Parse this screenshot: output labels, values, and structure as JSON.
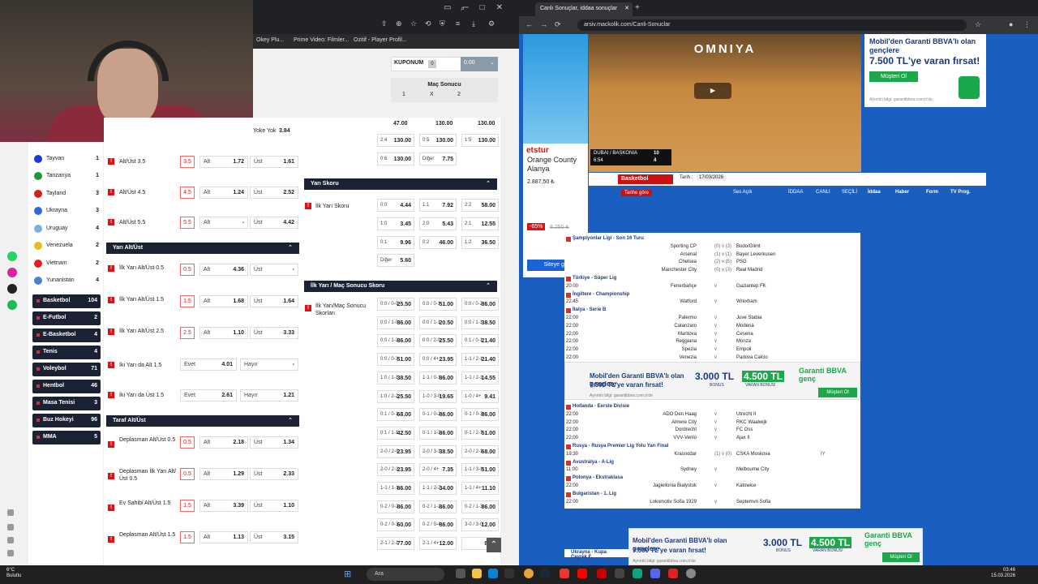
{
  "left_browser": {
    "bookmarks": [
      "Okey Plu...",
      "Prime Video: Filmler...",
      "Ozitif - Player Profil..."
    ],
    "coupon": {
      "label": "KUPONUM",
      "count": "0",
      "amount": "0.00"
    },
    "match_result": {
      "title": "Maç Sonucu",
      "cols": [
        "1",
        "X",
        "2"
      ]
    },
    "countries": [
      {
        "name": "Tayvan",
        "count": "1"
      },
      {
        "name": "Tanzanya",
        "count": "1"
      },
      {
        "name": "Tayland",
        "count": "3"
      },
      {
        "name": "Ukrayna",
        "count": "3"
      },
      {
        "name": "Uruguay",
        "count": "4"
      },
      {
        "name": "Venezuela",
        "count": "2"
      },
      {
        "name": "Vietnam",
        "count": "2"
      },
      {
        "name": "Yunanistan",
        "count": "4"
      }
    ],
    "sports": [
      {
        "name": "Basketbol",
        "count": "104"
      },
      {
        "name": "E-Futbol",
        "count": "2"
      },
      {
        "name": "E-Basketbol",
        "count": "4"
      },
      {
        "name": "Tenis",
        "count": "4"
      },
      {
        "name": "Voleybol",
        "count": "71"
      },
      {
        "name": "Hentbol",
        "count": "46"
      },
      {
        "name": "Masa Tenisi",
        "count": "3"
      },
      {
        "name": "Buz Hokeyi",
        "count": "96"
      },
      {
        "name": "MMA",
        "count": "5"
      }
    ],
    "col1": {
      "top_partial": {
        "label": "Yoke Yok",
        "value": "3.84"
      },
      "alt_ust": [
        {
          "label": "Alt/Üst 3.5",
          "line": "3.5",
          "alt": "1.72",
          "ust": "1.61"
        },
        {
          "label": "Alt/Üst 4.5",
          "line": "4.5",
          "alt": "1.24",
          "ust": "2.52"
        },
        {
          "label": "Alt/Üst 5.5",
          "line": "5.5",
          "alt": "-",
          "ust": "4.42"
        }
      ],
      "yari_title": "Yarı Alt/Üst",
      "yari": [
        {
          "label": "İlk Yarı Alt/Üst 0.5",
          "line": "0.5",
          "alt": "4.36",
          "ust": "-"
        },
        {
          "label": "İlk Yarı Alt/Üst 1.5",
          "line": "1.5",
          "alt": "1.68",
          "ust": "1.64"
        },
        {
          "label": "İlk Yarı Alt/Üst 2.5",
          "line": "2.5",
          "alt": "1.10",
          "ust": "3.33"
        }
      ],
      "iki_yari": [
        {
          "label": "İki Yarı da Alt 1.5",
          "k1": "Evet",
          "v1": "4.01",
          "k2": "Hayır",
          "v2": "-"
        },
        {
          "label": "İki Yarı da Üst 1.5",
          "k1": "Evet",
          "v1": "2.61",
          "k2": "Hayır",
          "v2": "1.21"
        }
      ],
      "taraf_title": "Taraf Alt/Üst",
      "taraf": [
        {
          "label": "Deplasman Alt/Üst 0.5",
          "line": "0.5",
          "alt": "2.18",
          "ust": "1.34"
        },
        {
          "label": "Deplasman İlk Yarı Alt/Üst 0.5",
          "line": "0.5",
          "alt": "1.29",
          "ust": "2.33"
        },
        {
          "label": "Ev Sahibi Alt/Üst 1.5",
          "line": "1.5",
          "alt": "3.39",
          "ust": "1.10"
        },
        {
          "label": "Deplasman Alt/Üst 1.5",
          "line": "1.5",
          "alt": "1.13",
          "ust": "3.15"
        }
      ],
      "k_alt": "Alt",
      "k_ust": "Üst"
    },
    "col2": {
      "top_cells": [
        [
          "2:4",
          "130.00",
          "0:5",
          "130.00",
          "1:5",
          "130.00"
        ],
        [
          "0:6",
          "130.00",
          "Diğer",
          "7.75",
          "",
          ""
        ]
      ],
      "top_partial": [
        "47.00",
        "130.00",
        "130.00"
      ],
      "yari_skor_title": "Yarı Skoru",
      "yari_skor_label": "İlk Yarı Skoru",
      "yari_skor": [
        [
          "0:0",
          "4.44",
          "1:1",
          "7.92",
          "2:2",
          "58.00"
        ],
        [
          "1:0",
          "3.45",
          "2:0",
          "5.43",
          "2:1",
          "12.55"
        ],
        [
          "0:1",
          "9.96",
          "0:2",
          "46.00",
          "1:2",
          "36.50"
        ]
      ],
      "yari_skor_other": {
        "k": "Diğer",
        "v": "5.60"
      },
      "ym_title": "İlk Yarı / Maç Sonucu Skoru",
      "ym_label": "İlk Yarı/Maç Sonucu Skorları",
      "ym": [
        [
          "0:0 / 0-0",
          "25.50",
          "0:0 / 0-1",
          "51.00",
          "0:0 / 0-2",
          "86.00"
        ],
        [
          "0:0 / 1-0",
          "86.00",
          "0:0 / 1-1",
          "20.50",
          "0:0 / 1-1",
          "38.50"
        ],
        [
          "0:0 / 1-2",
          "86.00",
          "0:0 / 2-0",
          "25.50",
          "0:1 / 0-1",
          "21.40"
        ],
        [
          "0:0 / 0-3",
          "51.00",
          "0:0 / 4+",
          "23.95",
          "1-1 / 2-1",
          "21.40"
        ],
        [
          "1:0 / 1-1",
          "38.50",
          "1-1 / 0-1",
          "86.00",
          "1-1 / 2-1",
          "14.55"
        ],
        [
          "1:0 / 2-2",
          "25.50",
          "1-0 / 3-0",
          "19.65",
          "1-0 / 4+",
          "9.41"
        ],
        [
          "0:1 / 0-1",
          "68.00",
          "0-1 / 0-2",
          "86.00",
          "0-1 / 0-3",
          "86.00"
        ],
        [
          "0:1 / 1-1",
          "42.50",
          "0-1 / 1-2",
          "86.00",
          "0-1 / 2-1",
          "51.00"
        ],
        [
          "2-0 / 2-0",
          "23.95",
          "2-0 / 3-1",
          "38.50",
          "2-0 / 2-1",
          "68.00"
        ],
        [
          "2-0 / 2-2",
          "23.95",
          "2-0 / 4+",
          "7.35",
          "1-1 / 3-1",
          "51.00"
        ],
        [
          "1-1 / 1-1",
          "86.00",
          "1-1 / 2-2",
          "34.00",
          "1-1 / 4+",
          "11.10"
        ],
        [
          "0-2 / 0-2",
          "86.00",
          "0-2 / 1-2",
          "86.00",
          "0-2 / 1-3",
          "86.00"
        ],
        [
          "0-2 / 0-3",
          "60.00",
          "0-2 / 0-4",
          "86.00",
          "3-0 / 3-0",
          "12.00"
        ],
        [
          "2-1 / 2-1",
          "77.00",
          "2-1 / 4+",
          "12.00",
          "",
          "86.0"
        ]
      ]
    }
  },
  "right_browser": {
    "tab_title": "Canlı Sonuçlar, iddaa sonuçlar",
    "url": "arsiv.mackolik.com/Canli-Sonuclar",
    "ad_left": {
      "brand": "etstur",
      "name": "Orange County Alanya",
      "price": "2.887,50 ₺",
      "discount": "-65%",
      "old_price": "8.250 ₺",
      "cta": "Siteye git"
    },
    "video": {
      "banner": "OMNIYA",
      "score_home": "10",
      "score_away": "4",
      "clock": "6:54",
      "bug_teams": "DUBAI / BASKONIA"
    },
    "ad_top": {
      "line1": "Mobil'den Garanti BBVA'lı olan gençlere",
      "line2": "7.500 TL'ye varan fırsat!",
      "btn": "Müşteri Ol",
      "foot": "Ayrıntılı bilgi: garantibbva.com.tr'de."
    },
    "nav": {
      "sport": "Basketbol",
      "date_label": "Tarih :",
      "date": "17/03/2026",
      "order": "Tarihe göre"
    },
    "filters": [
      "Ses Açık",
      "İDDAA",
      "CANLI",
      "SEÇİLİ",
      "İddaa",
      "Haber",
      "Form",
      "TV Prog."
    ],
    "rows": [
      {
        "type": "lg",
        "name": "Şampiyonlar Ligi - Son 16 Turu"
      },
      {
        "type": "m",
        "time": "",
        "home": "Sporting CP",
        "score": "(0) v (3)",
        "away": "Bodo/Glimt",
        "iy": ""
      },
      {
        "type": "m",
        "time": "",
        "home": "Arsenal",
        "score": "(1) v (1)",
        "away": "Bayer Leverkusen",
        "iy": ""
      },
      {
        "type": "m",
        "time": "",
        "home": "Chelsea",
        "score": "(2) v (5)",
        "away": "PSG",
        "iy": ""
      },
      {
        "type": "m",
        "time": "",
        "home": "Manchester City",
        "score": "(0) v (3)",
        "away": "Real Madrid",
        "iy": ""
      },
      {
        "type": "lg",
        "name": "Türkiye - Süper Lig"
      },
      {
        "type": "m",
        "time": "20:00",
        "home": "Fenerbahçe",
        "score": "v",
        "away": "Gaziantep FK",
        "iy": ""
      },
      {
        "type": "lg",
        "name": "İngiltere - Championship"
      },
      {
        "type": "m",
        "time": "22:45",
        "home": "Watford",
        "score": "v",
        "away": "Wrexham",
        "iy": ""
      },
      {
        "type": "lg",
        "name": "İtalya - Serie B"
      },
      {
        "type": "m",
        "time": "22:00",
        "home": "Palermo",
        "score": "v",
        "away": "Juve Stabia",
        "iy": ""
      },
      {
        "type": "m",
        "time": "22:00",
        "home": "Catanzaro",
        "score": "v",
        "away": "Modena",
        "iy": ""
      },
      {
        "type": "m",
        "time": "22:00",
        "home": "Mantova",
        "score": "v",
        "away": "Cesena",
        "iy": ""
      },
      {
        "type": "m",
        "time": "22:00",
        "home": "Reggiana",
        "score": "v",
        "away": "Monza",
        "iy": ""
      },
      {
        "type": "m",
        "time": "22:00",
        "home": "Spezia",
        "score": "v",
        "away": "Empoli",
        "iy": ""
      },
      {
        "type": "m",
        "time": "22:00",
        "home": "Venezia",
        "score": "v",
        "away": "Padova Calcio",
        "iy": ""
      }
    ],
    "rows2": [
      {
        "type": "lg",
        "name": "Hollanda - Eerste Divisie"
      },
      {
        "type": "m",
        "time": "22:00",
        "home": "ADO Den Haag",
        "score": "v",
        "away": "Utrecht II",
        "iy": ""
      },
      {
        "type": "m",
        "time": "22:00",
        "home": "Almere City",
        "score": "v",
        "away": "RKC Waalwijk",
        "iy": ""
      },
      {
        "type": "m",
        "time": "22:00",
        "home": "Dordrecht",
        "score": "v",
        "away": "FC Oss",
        "iy": ""
      },
      {
        "type": "m",
        "time": "22:00",
        "home": "VVV-Venlo",
        "score": "v",
        "away": "Ajax II",
        "iy": ""
      },
      {
        "type": "lg",
        "name": "Rusya - Rusya Premier Lig Yolu Yarı Final"
      },
      {
        "type": "m",
        "time": "19:30",
        "home": "Krasnodar",
        "score": "(1) v (0)",
        "away": "CSKA Moskova",
        "iy": "İY"
      },
      {
        "type": "lg",
        "name": "Avustralya - A-Lig"
      },
      {
        "type": "m",
        "time": "11:00",
        "home": "Sydney",
        "score": "v",
        "away": "Melbourne City",
        "iy": ""
      },
      {
        "type": "lg",
        "name": "Polonya - Ekstraklasa"
      },
      {
        "type": "m",
        "time": "22:00",
        "home": "Jagiellonia Bialystok",
        "score": "v",
        "away": "Katowice",
        "iy": ""
      },
      {
        "type": "lg",
        "name": "Bulgaristan - 1. Lig"
      },
      {
        "type": "m",
        "time": "22:00",
        "home": "Lokomotiv Sofia 1929",
        "score": "v",
        "away": "Septemvri Sofia",
        "iy": ""
      }
    ],
    "ad_mid": {
      "line1": "Mobil'den Garanti BBVA'lı olan gençlere",
      "line2": "7.500 TL'ye varan fırsat!",
      "b1": "3.000 TL",
      "sb1": "BONUS",
      "b2": "4.500 TL",
      "sb2": "VARAN BONUS!",
      "logo": "Garanti BBVA genç",
      "btn": "Müşteri Ol",
      "foot": "Ayrıntılı bilgi: garantibbva.com.tr'de"
    },
    "ukr": "Ukrayna - Kupa Çeyrek F."
  },
  "taskbar": {
    "weather_temp": "6°C",
    "weather_desc": "Bulutlu",
    "search": "Ara",
    "time": "03:46",
    "date": "15.03.2026"
  },
  "colors": {
    "navy": "#1a2233",
    "accent_red": "#d11",
    "blue_bg": "#1a5fc0",
    "green": "#1aa84a"
  }
}
